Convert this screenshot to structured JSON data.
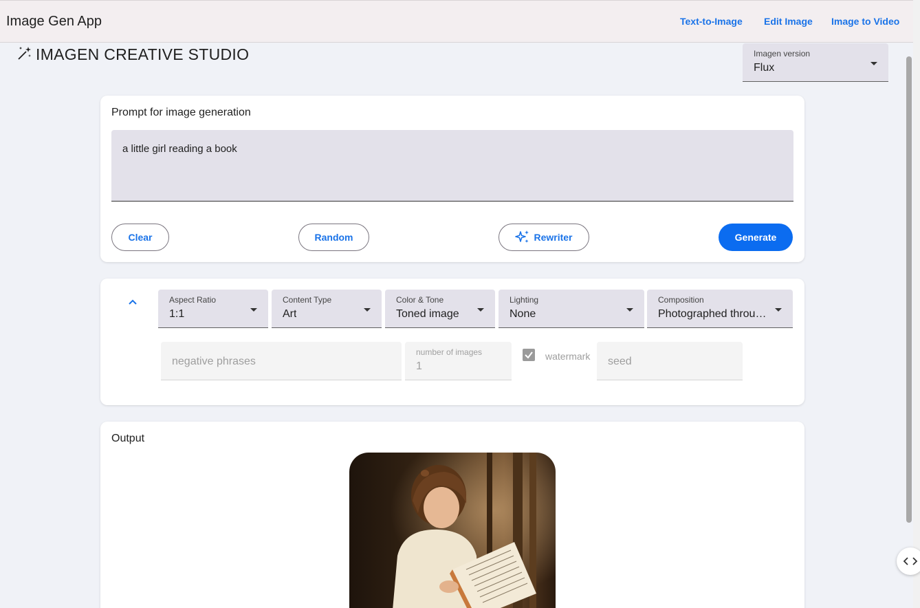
{
  "app": {
    "title": "Image Gen App"
  },
  "nav": [
    {
      "label": "Text-to-Image"
    },
    {
      "label": "Edit Image"
    },
    {
      "label": "Image to Video"
    }
  ],
  "studio": {
    "title": "IMAGEN CREATIVE STUDIO"
  },
  "version_select": {
    "label": "Imagen version",
    "value": "Flux"
  },
  "prompt": {
    "heading": "Prompt for image generation",
    "value": "a little girl reading a book",
    "buttons": {
      "clear": "Clear",
      "random": "Random",
      "rewriter": "Rewriter",
      "generate": "Generate"
    }
  },
  "options": {
    "aspect_ratio": {
      "label": "Aspect Ratio",
      "value": "1:1"
    },
    "content_type": {
      "label": "Content Type",
      "value": "Art"
    },
    "color_tone": {
      "label": "Color & Tone",
      "value": "Toned image"
    },
    "lighting": {
      "label": "Lighting",
      "value": "None"
    },
    "composition": {
      "label": "Composition",
      "value": "Photographed through window"
    },
    "negative_phrases": {
      "placeholder": "negative phrases"
    },
    "number_of_images": {
      "label": "number of images",
      "value": "1"
    },
    "watermark": {
      "label": "watermark",
      "checked": true
    },
    "seed": {
      "placeholder": "seed"
    }
  },
  "output": {
    "heading": "Output",
    "image_alt": "little girl reading a book by a window"
  },
  "colors": {
    "accent": "#1a73e8",
    "primary_button": "#0b6cf0",
    "page_bg": "#f0f2f7",
    "field_bg": "#e3e1ea"
  }
}
